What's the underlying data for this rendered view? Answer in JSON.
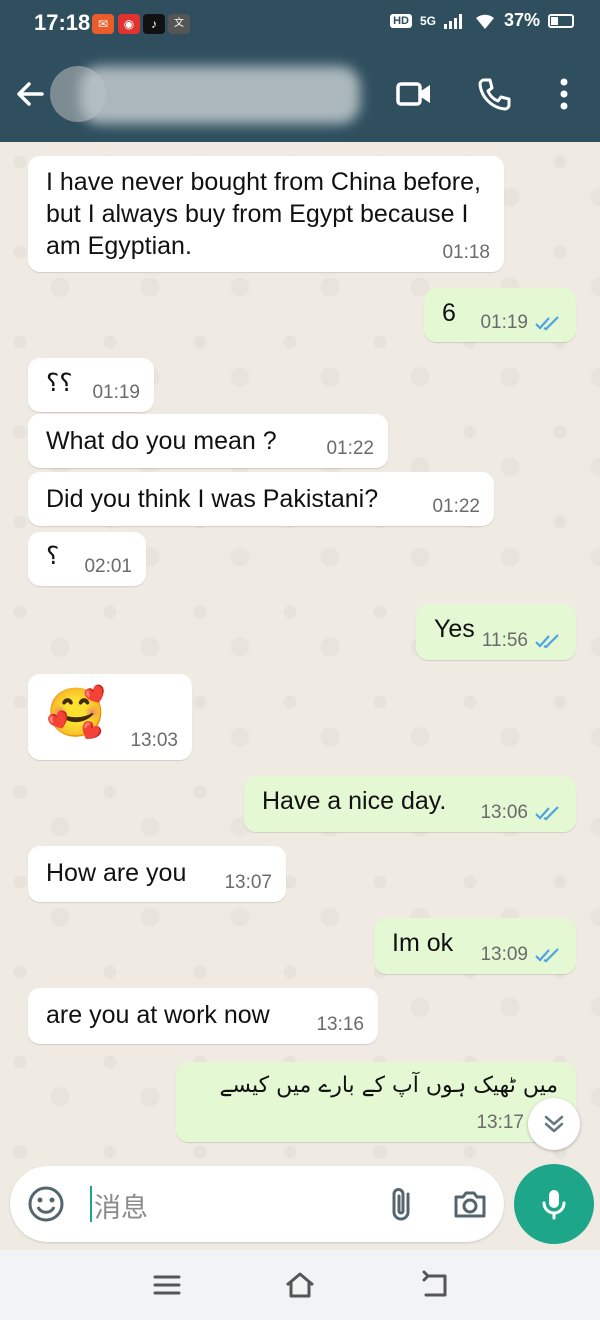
{
  "status_bar": {
    "time": "17:18",
    "notification_icons": [
      "app-notification-icon",
      "weibo-icon",
      "tiktok-icon",
      "news-icon"
    ],
    "hd_label": "HD",
    "network_label": "5G",
    "battery": "37%"
  },
  "header": {
    "contact_name_hidden": true
  },
  "messages": [
    {
      "dir": "in",
      "text": "I have never bought from China before, but I always buy from Egypt because I am Egyptian.",
      "time": "01:18"
    },
    {
      "dir": "out",
      "text": "6",
      "time": "01:19",
      "read": true
    },
    {
      "dir": "in",
      "text": "؟؟",
      "time": "01:19"
    },
    {
      "dir": "in",
      "text": "What do you mean ?",
      "time": "01:22"
    },
    {
      "dir": "in",
      "text": "Did you think I was Pakistani?",
      "time": "01:22"
    },
    {
      "dir": "in",
      "text": "؟",
      "time": "02:01"
    },
    {
      "dir": "out",
      "text": "Yes",
      "time": "11:56",
      "read": true
    },
    {
      "dir": "in",
      "text": "🥰",
      "time": "13:03"
    },
    {
      "dir": "out",
      "text": "Have a nice day.",
      "time": "13:06",
      "read": true
    },
    {
      "dir": "in",
      "text": "How are you",
      "time": "13:07"
    },
    {
      "dir": "out",
      "text": "Im ok",
      "time": "13:09",
      "read": true
    },
    {
      "dir": "in",
      "text": "are you at work now",
      "time": "13:16"
    },
    {
      "dir": "out",
      "text": "میں ٹھیک ہوں آپ کے بارے میں کیسے",
      "time": "13:17",
      "read": false
    }
  ],
  "composer": {
    "placeholder": "消息"
  },
  "colors": {
    "header": "#2f4f5f",
    "incoming_bubble": "#ffffff",
    "outgoing_bubble": "#e4f8d4",
    "read_ticks": "#4fa3e0",
    "accent": "#1da68a"
  }
}
